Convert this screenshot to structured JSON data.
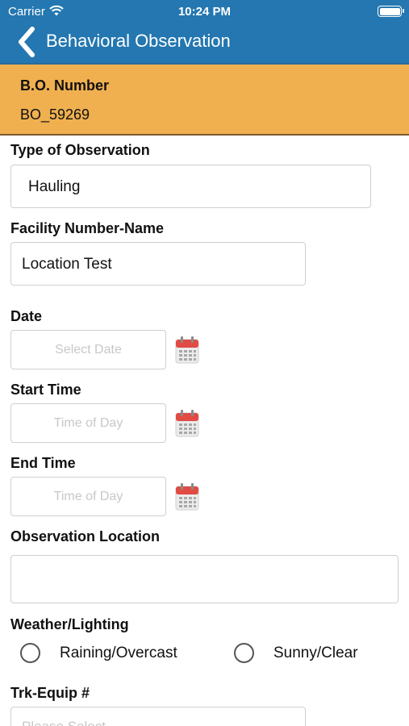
{
  "status_bar": {
    "carrier": "Carrier",
    "time": "10:24 PM",
    "icons": [
      "wifi-icon",
      "battery-icon"
    ]
  },
  "nav": {
    "title": "Behavioral Observation",
    "back_icon": "chevron-left-icon"
  },
  "bo": {
    "label": "B.O. Number",
    "value": "BO_59269"
  },
  "form": {
    "type_label": "Type of Observation",
    "type_value": "Hauling",
    "facility_label": "Facility Number-Name",
    "facility_value": "Location Test",
    "date_label": "Date",
    "date_placeholder": "Select Date",
    "start_label": "Start Time",
    "start_placeholder": "Time of Day",
    "end_label": "End Time",
    "end_placeholder": "Time of Day",
    "location_label": "Observation Location",
    "location_value": "",
    "weather_label": "Weather/Lighting",
    "weather_options": [
      "Raining/Overcast",
      "Sunny/Clear"
    ],
    "trk_label": "Trk-Equip #",
    "trk_placeholder": "Please Select"
  },
  "colors": {
    "nav_blue": "#2477b0",
    "bo_orange": "#f0b050",
    "calendar_red": "#e14b43",
    "placeholder_gray": "#c8c8c8"
  }
}
